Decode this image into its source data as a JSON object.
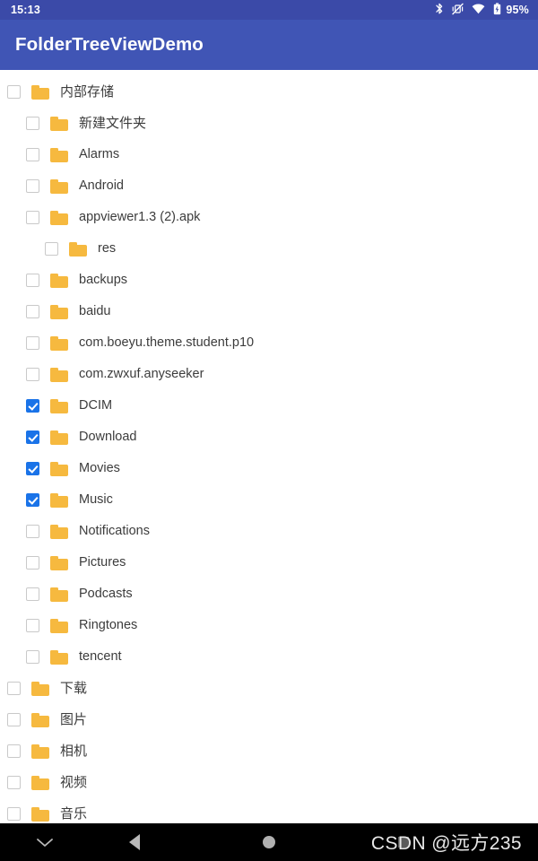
{
  "status_bar": {
    "clock": "15:13",
    "battery_percent": "95%",
    "icons": [
      "bluetooth-icon",
      "vibrate-off-icon",
      "wifi-icon",
      "battery-icon"
    ],
    "background_color": "#3b4aa8",
    "text_color": "#ffffff"
  },
  "app_bar": {
    "title": "FolderTreeViewDemo",
    "background_color": "#4055b5",
    "title_color": "#ffffff"
  },
  "theme": {
    "folder_color": "#f6b93f",
    "checkbox_checked_color": "#1a73e8",
    "checkbox_border_color": "#c9c9c9",
    "label_color": "#3c3c3c",
    "page_background": "#ffffff"
  },
  "tree": {
    "items": [
      {
        "label": "内部存储",
        "level": 0,
        "checked": false,
        "cjk": true
      },
      {
        "label": "新建文件夹",
        "level": 1,
        "checked": false,
        "cjk": true
      },
      {
        "label": "Alarms",
        "level": 1,
        "checked": false,
        "cjk": false
      },
      {
        "label": "Android",
        "level": 1,
        "checked": false,
        "cjk": false
      },
      {
        "label": "appviewer1.3 (2).apk",
        "level": 1,
        "checked": false,
        "cjk": false
      },
      {
        "label": "res",
        "level": 2,
        "checked": false,
        "cjk": false
      },
      {
        "label": "backups",
        "level": 1,
        "checked": false,
        "cjk": false
      },
      {
        "label": "baidu",
        "level": 1,
        "checked": false,
        "cjk": false
      },
      {
        "label": "com.boeyu.theme.student.p10",
        "level": 1,
        "checked": false,
        "cjk": false
      },
      {
        "label": "com.zwxuf.anyseeker",
        "level": 1,
        "checked": false,
        "cjk": false
      },
      {
        "label": "DCIM",
        "level": 1,
        "checked": true,
        "cjk": false
      },
      {
        "label": "Download",
        "level": 1,
        "checked": true,
        "cjk": false
      },
      {
        "label": "Movies",
        "level": 1,
        "checked": true,
        "cjk": false
      },
      {
        "label": "Music",
        "level": 1,
        "checked": true,
        "cjk": false
      },
      {
        "label": "Notifications",
        "level": 1,
        "checked": false,
        "cjk": false
      },
      {
        "label": "Pictures",
        "level": 1,
        "checked": false,
        "cjk": false
      },
      {
        "label": "Podcasts",
        "level": 1,
        "checked": false,
        "cjk": false
      },
      {
        "label": "Ringtones",
        "level": 1,
        "checked": false,
        "cjk": false
      },
      {
        "label": "tencent",
        "level": 1,
        "checked": false,
        "cjk": false
      },
      {
        "label": "下载",
        "level": 0,
        "checked": false,
        "cjk": true
      },
      {
        "label": "图片",
        "level": 0,
        "checked": false,
        "cjk": true
      },
      {
        "label": "相机",
        "level": 0,
        "checked": false,
        "cjk": true
      },
      {
        "label": "视频",
        "level": 0,
        "checked": false,
        "cjk": true
      },
      {
        "label": "音乐",
        "level": 0,
        "checked": false,
        "cjk": true
      }
    ]
  },
  "nav_bar": {
    "background_color": "#000000",
    "buttons": [
      {
        "name": "hide-keyboard-button",
        "icon": "chevron-down-icon"
      },
      {
        "name": "back-button",
        "icon": "triangle-back-icon"
      },
      {
        "name": "home-button",
        "icon": "circle-home-icon"
      },
      {
        "name": "recents-button",
        "icon": "square-recents-icon"
      }
    ],
    "watermark": "CSDN @远方235"
  }
}
